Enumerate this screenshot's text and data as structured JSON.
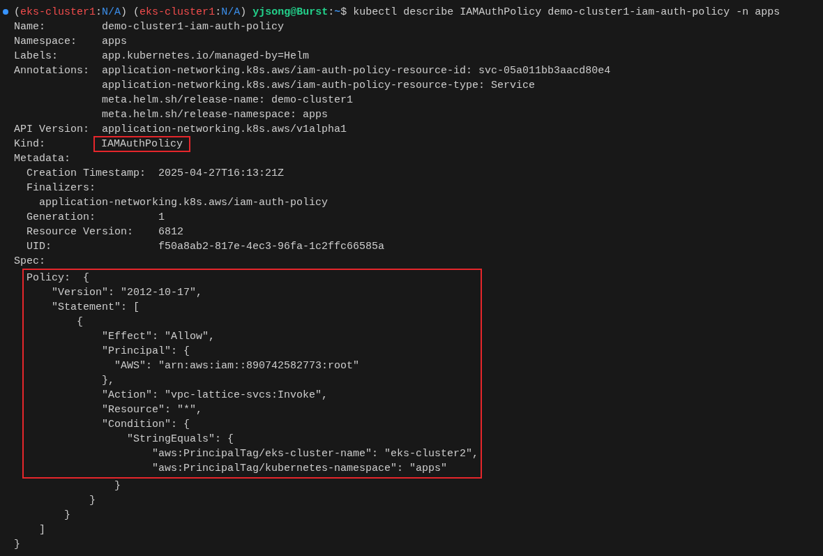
{
  "prompt": {
    "segments": [
      {
        "text": "(",
        "kind": "plain"
      },
      {
        "text": "eks-cluster1",
        "kind": "context"
      },
      {
        "text": ":",
        "kind": "plain"
      },
      {
        "text": "N/A",
        "kind": "namespace"
      },
      {
        "text": ")",
        "kind": "plain"
      },
      {
        "text": " (",
        "kind": "plain"
      },
      {
        "text": "eks-cluster1",
        "kind": "context"
      },
      {
        "text": ":",
        "kind": "plain"
      },
      {
        "text": "N/A",
        "kind": "namespace"
      },
      {
        "text": ")",
        "kind": "plain"
      },
      {
        "text": " yjsong@Burst",
        "kind": "user"
      },
      {
        "text": ":",
        "kind": "plain"
      },
      {
        "text": "~",
        "kind": "path"
      },
      {
        "text": "$ kubectl describe IAMAuthPolicy demo-cluster1-iam-auth-policy -n apps",
        "kind": "plain"
      }
    ]
  },
  "fields": [
    {
      "label": "Name:",
      "values": [
        "demo-cluster1-iam-auth-policy"
      ],
      "highlighted": false
    },
    {
      "label": "Namespace:",
      "values": [
        "apps"
      ],
      "highlighted": false
    },
    {
      "label": "Labels:",
      "values": [
        "app.kubernetes.io/managed-by=Helm"
      ],
      "highlighted": false
    },
    {
      "label": "Annotations:",
      "values": [
        "application-networking.k8s.aws/iam-auth-policy-resource-id: svc-05a011bb3aacd80e4",
        "application-networking.k8s.aws/iam-auth-policy-resource-type: Service",
        "meta.helm.sh/release-name: demo-cluster1",
        "meta.helm.sh/release-namespace: apps"
      ],
      "highlighted": false
    },
    {
      "label": "API Version:",
      "values": [
        "application-networking.k8s.aws/v1alpha1"
      ],
      "highlighted": false
    },
    {
      "label": "Kind:",
      "values": [
        "IAMAuthPolicy"
      ],
      "highlighted": true
    }
  ],
  "metadata": {
    "label": "Metadata:",
    "fields": [
      {
        "kind": "field",
        "label": "Creation Timestamp:",
        "values": [
          "2025-04-27T16:13:21Z"
        ]
      },
      {
        "kind": "field",
        "label": "Finalizers:"
      },
      {
        "kind": "list_item",
        "values": [
          "application-networking.k8s.aws/iam-auth-policy"
        ]
      },
      {
        "kind": "field",
        "label": "Generation:",
        "values": [
          "1"
        ]
      },
      {
        "kind": "field",
        "label": "Resource Version:",
        "values": [
          "6812"
        ]
      },
      {
        "kind": "field",
        "label": "UID:",
        "values": [
          "f50a8ab2-817e-4ec3-96fa-1c2ffc66585a"
        ]
      }
    ]
  },
  "spec": {
    "label": "Spec:",
    "policy_label": "Policy:",
    "boxed_lines": [
      "{",
      "    \"Version\": \"2012-10-17\",",
      "    \"Statement\": [",
      "        {",
      "            \"Effect\": \"Allow\",",
      "            \"Principal\": {",
      "              \"AWS\": \"arn:aws:iam::890742582773:root\"",
      "            },",
      "            \"Action\": \"vpc-lattice-svcs:Invoke\",",
      "            \"Resource\": \"*\",",
      "            \"Condition\": {",
      "                \"StringEquals\": {",
      "                    \"aws:PrincipalTag/eks-cluster-name\": \"eks-cluster2\",",
      "                    \"aws:PrincipalTag/kubernetes-namespace\": \"apps\""
    ],
    "trailing_lines": [
      "                }",
      "            }",
      "        }",
      "    ]",
      "}"
    ]
  }
}
